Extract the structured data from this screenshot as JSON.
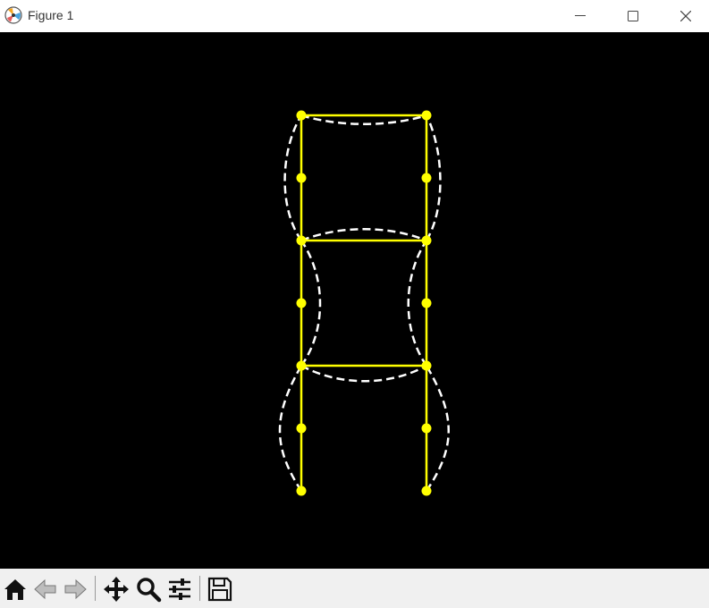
{
  "window": {
    "title": "Figure 1",
    "app_icon": "matplotlib-logo-icon"
  },
  "window_controls": [
    "minimize-icon",
    "maximize-icon",
    "close-icon"
  ],
  "figure": {
    "background": "#000000",
    "frame_color": "#ffff00",
    "deformed_shape_color": "#ffffff",
    "deformed_shape_style": "dashed"
  },
  "toolbar": {
    "tools": [
      "home-icon",
      "back-icon",
      "forward-icon",
      "pan-icon",
      "zoom-icon",
      "configure-subplots-icon",
      "save-icon"
    ]
  }
}
